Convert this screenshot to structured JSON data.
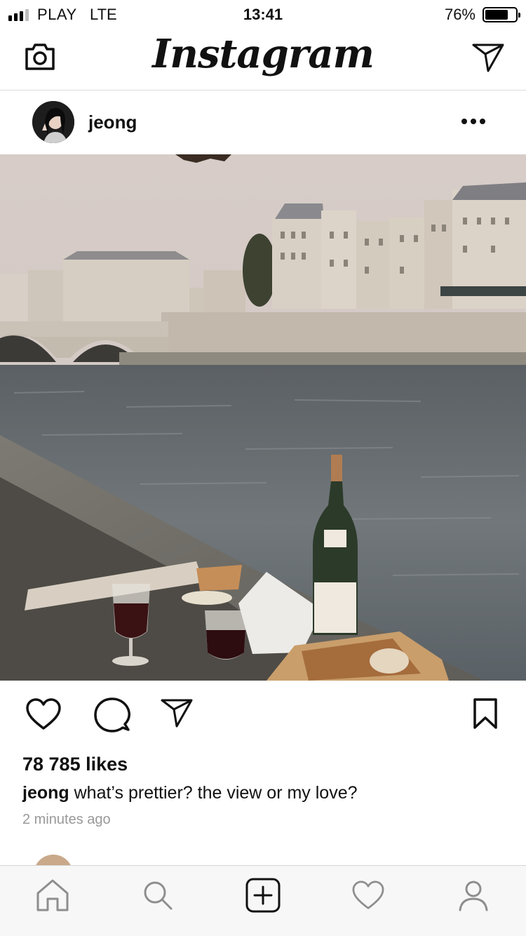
{
  "status_bar": {
    "carrier": "PLAY",
    "network": "LTE",
    "time": "13:41",
    "battery_percent": "76%",
    "battery_level": 0.76
  },
  "header": {
    "logo": "Instagram",
    "left_icon": "camera-icon",
    "right_icon": "paper-plane-icon"
  },
  "post": {
    "username": "jeong",
    "more_icon": "more-dots-icon",
    "likes": "78 785 likes",
    "caption_user": "jeong",
    "caption_text": " what’s prettier? the view or my love?",
    "time_ago": "2 minutes ago",
    "actions": [
      "heart-icon",
      "comment-icon",
      "paper-plane-icon",
      "bookmark-icon"
    ]
  },
  "tab_bar": {
    "items": [
      "home-icon",
      "search-icon",
      "add-icon",
      "heart-icon",
      "profile-icon"
    ],
    "active": "home-icon"
  },
  "colors": {
    "text": "#111111",
    "muted": "#999999",
    "divider": "#dbdbdb",
    "tab_bg": "#f7f7f7",
    "tab_icon": "#8e8e8e"
  }
}
